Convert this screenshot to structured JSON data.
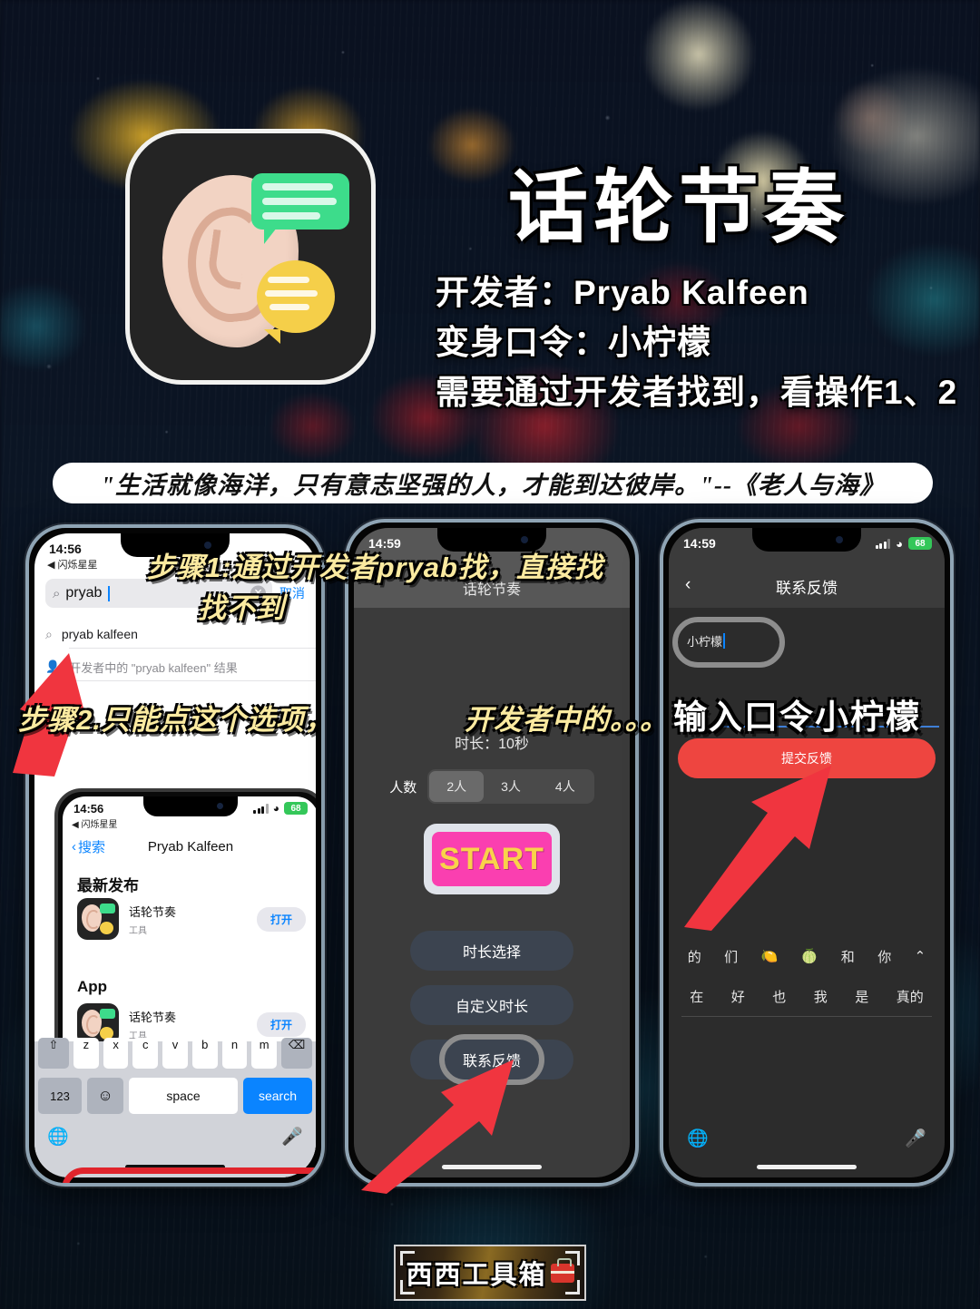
{
  "header": {
    "title": "话轮节奏",
    "developer_line": "开发者：Pryab Kalfeen",
    "password_line": "变身口令：小柠檬",
    "hint_line": "需要通过开发者找到，看操作1、2",
    "app_icon_name": "ear-with-speech-bubbles-icon"
  },
  "quote": {
    "text": "\"生活就像海洋，只有意志坚强的人，才能到达彼岸。\"--《老人与海》"
  },
  "annotations": {
    "step1_line1": "步骤1:通过开发者pryab找，直接找",
    "step1_line2": "找不到",
    "step2": "步骤2.只能点这个选项，",
    "step2_cont": "开发者中的。。。",
    "step3": "输入口令小柠檬"
  },
  "phone1": {
    "status": {
      "time": "14:56",
      "back_app": "◀ 闪烁星星"
    },
    "search": {
      "value": "pryab",
      "clear_label": "✕",
      "cancel_label": "取消"
    },
    "suggestions": [
      {
        "icon": "search-icon",
        "text": "pryab kalfeen"
      },
      {
        "icon": "person-icon",
        "text": "开发者中的 \"pryab kalfeen\" 结果"
      }
    ],
    "inner_phone": {
      "status": {
        "time": "14:56",
        "back_app": "◀ 闪烁星星",
        "signal": "signal-icon",
        "wifi": "wifi-icon",
        "battery": "68"
      },
      "nav": {
        "back_label": "搜索",
        "title": "Pryab Kalfeen"
      },
      "sections": [
        {
          "heading": "最新发布",
          "items": [
            {
              "name": "话轮节奏",
              "category": "工具",
              "action": "打开"
            }
          ]
        },
        {
          "heading": "App",
          "items": [
            {
              "name": "话轮节奏",
              "category": "工具",
              "action": "打开"
            }
          ]
        }
      ]
    },
    "keyboard": {
      "row1": [
        "z",
        "x",
        "c",
        "v",
        "b",
        "n",
        "m"
      ],
      "shift_label": "⇧",
      "delete_label": "⌫",
      "numbers_label": "123",
      "emoji_label": "☺",
      "space_label": "space",
      "search_label": "search",
      "globe_label": "globe-icon",
      "mic_label": "mic-icon"
    }
  },
  "phone2": {
    "status": {
      "time": "14:59"
    },
    "title": "话轮节奏",
    "duration_label": "时长：10秒",
    "people_label": "人数",
    "people_options": [
      {
        "label": "2人",
        "selected": true
      },
      {
        "label": "3人",
        "selected": false
      },
      {
        "label": "4人",
        "selected": false
      }
    ],
    "start_label": "START",
    "buttons": [
      {
        "label": "时长选择"
      },
      {
        "label": "自定义时长"
      },
      {
        "label": "联系反馈",
        "highlighted": true
      }
    ]
  },
  "phone3": {
    "status": {
      "time": "14:59",
      "signal": "signal-icon",
      "wifi": "wifi-icon",
      "battery": "68"
    },
    "nav": {
      "back_label": "‹",
      "title": "联系反馈"
    },
    "input": {
      "value": "小柠檬",
      "placeholder": ""
    },
    "submit_label": "提交反馈",
    "keyboard": {
      "row1": [
        "的",
        "们",
        "🍋",
        "🍈",
        "和",
        "你"
      ],
      "row1_expand": "⌃",
      "row2": [
        "在",
        "好",
        "也",
        "我",
        "是",
        "真的"
      ],
      "globe_label": "globe-icon",
      "mic_label": "mic-icon"
    }
  },
  "watermark": {
    "text": "西西工具箱",
    "icon": "toolbox-icon"
  },
  "colors": {
    "accent_red": "#e0242c",
    "accent_pink": "#fa3fb0",
    "accent_yellow": "#f9d24a",
    "ios_blue": "#0a84ff",
    "anno_yellow": "#fbeaa0",
    "battery_green": "#34c759"
  }
}
